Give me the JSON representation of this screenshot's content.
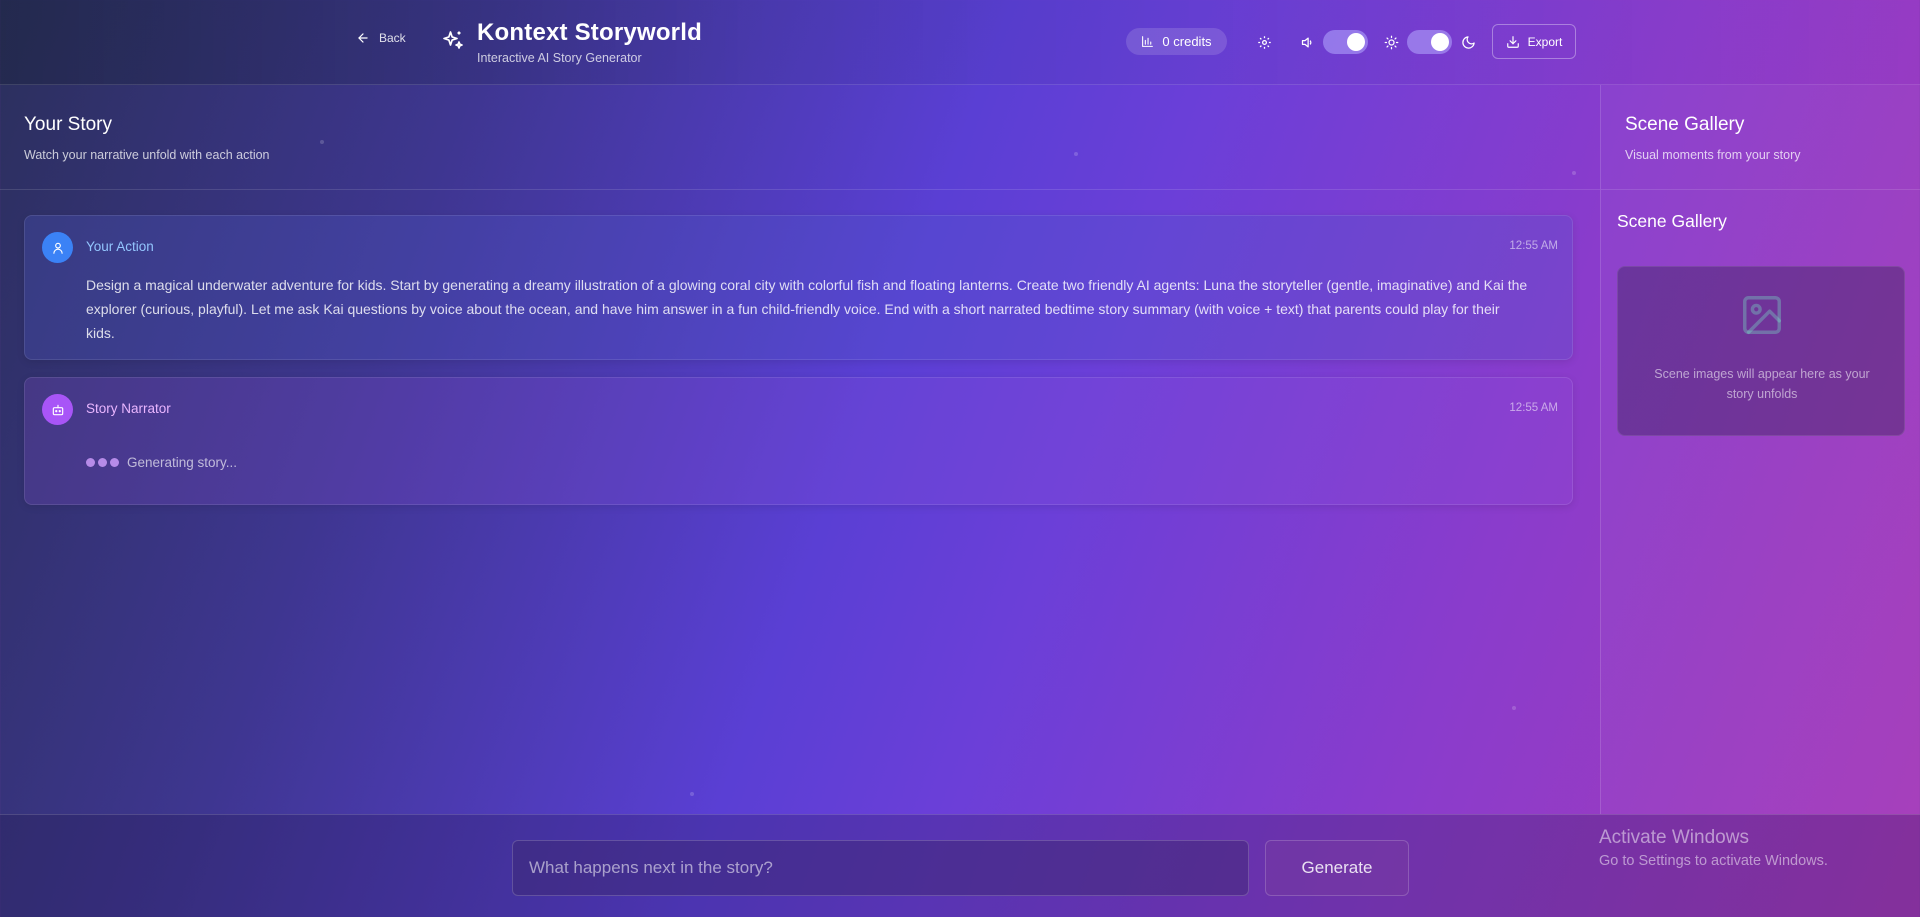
{
  "header": {
    "back_label": "Back",
    "app_title": "Kontext Storyworld",
    "app_subtitle": "Interactive AI Story Generator",
    "credits_label": "0 credits",
    "export_label": "Export",
    "sound_toggle_on": true,
    "theme_toggle_on": true
  },
  "story": {
    "title": "Your Story",
    "subtitle": "Watch your narrative unfold with each action",
    "messages": [
      {
        "role": "user",
        "label": "Your Action",
        "time": "12:55 AM",
        "text": "Design a magical underwater adventure for kids. Start by generating a dreamy illustration of a glowing coral city with colorful fish and floating lanterns. Create two friendly AI agents: Luna the storyteller (gentle, imaginative) and Kai the explorer (curious, playful). Let me ask Kai questions by voice about the ocean, and have him answer in a fun child-friendly voice. End with a short narrated bedtime story summary (with voice + text) that parents could play for their kids."
      },
      {
        "role": "narrator",
        "label": "Story Narrator",
        "time": "12:55 AM",
        "status": "Generating story..."
      }
    ]
  },
  "gallery": {
    "title": "Scene Gallery",
    "subtitle": "Visual moments from your story",
    "inner_title": "Scene Gallery",
    "empty_text": "Scene images will appear here as your story unfolds"
  },
  "composer": {
    "placeholder": "What happens next in the story?",
    "value": "",
    "generate_label": "Generate"
  },
  "watermark": {
    "title": "Activate Windows",
    "subtitle": "Go to Settings to activate Windows."
  },
  "colors": {
    "user_accent": "#3b82f6",
    "narrator_accent": "#a855f7",
    "user_label": "#93c5fd",
    "narrator_label": "#e9b6ff"
  }
}
